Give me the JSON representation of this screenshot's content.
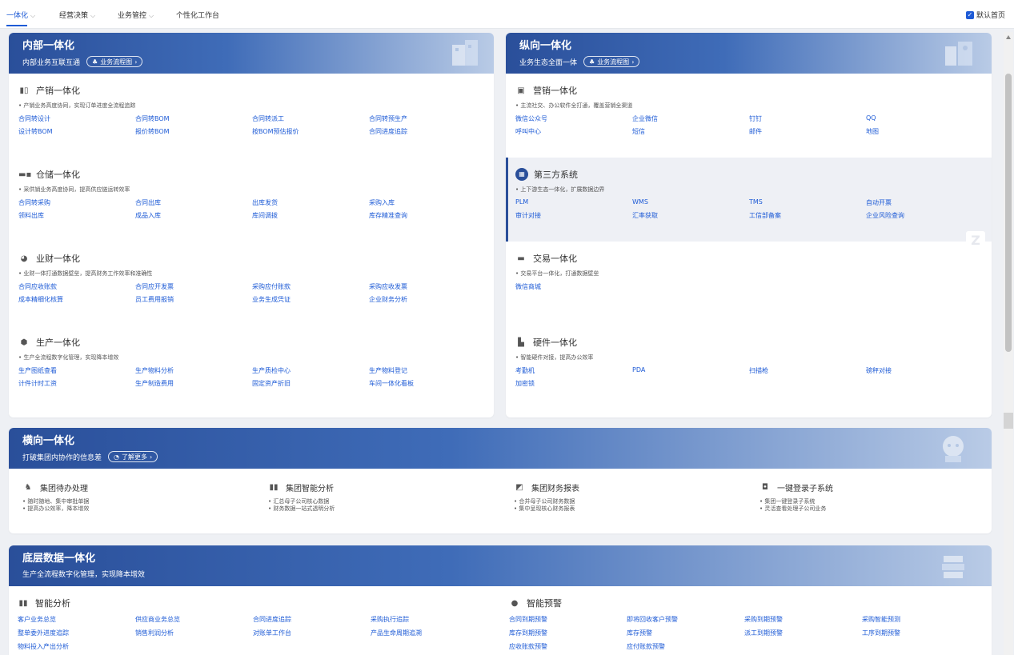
{
  "topnav": {
    "tabs": [
      {
        "label": "一体化",
        "chevron": true
      },
      {
        "label": "经营决策",
        "chevron": true
      },
      {
        "label": "业务管控",
        "chevron": true
      },
      {
        "label": "个性化工作台",
        "chevron": false
      }
    ],
    "default_home_label": "默认首页",
    "default_home_checked": true
  },
  "internal": {
    "title": "内部一体化",
    "subtitle": "内部业务互联互通",
    "pill": "业务流程图",
    "sections": [
      {
        "icon": "building-icon",
        "glyph": "▮▯",
        "title": "产销一体化",
        "desc": "• 产销业务高度协同，实现订单进度全流程追踪",
        "links": [
          "合同转设计",
          "合同转BOM",
          "合同转派工",
          "合同转预生产",
          "设计转BOM",
          "报价转BOM",
          "按BOM预估报价",
          "合同进度追踪"
        ]
      },
      {
        "icon": "truck-icon",
        "glyph": "▬▪",
        "title": "仓储一体化",
        "desc": "• 采供销业务高度协同，提高供应链运转效率",
        "links": [
          "合同转采购",
          "合同出库",
          "出库发货",
          "采购入库",
          "领料出库",
          "成品入库",
          "库间调拨",
          "库存精准查询"
        ]
      },
      {
        "icon": "pie-chart-icon",
        "glyph": "◕",
        "title": "业财一体化",
        "desc": "• 业财一体打通数据壁垒，提高财务工作效率和准确性",
        "links": [
          "合同应收账款",
          "合同应开发票",
          "采购应付账款",
          "采购应收发票",
          "成本精细化核算",
          "员工费用报销",
          "业务生成凭证",
          "企业财务分析"
        ]
      },
      {
        "icon": "cube-icon",
        "glyph": "⬢",
        "title": "生产一体化",
        "desc": "• 生产全流程数字化管理，实现降本增效",
        "links": [
          "生产图纸查看",
          "生产物料分析",
          "生产质检中心",
          "生产物料登记",
          "计件计时工资",
          "生产制造费用",
          "固定资产折旧",
          "车间一体化看板"
        ]
      }
    ]
  },
  "vertical": {
    "title": "纵向一体化",
    "subtitle": "业务生态全面一体",
    "pill": "业务流程图",
    "sections": [
      {
        "icon": "marketing-icon",
        "glyph": "▣",
        "title": "营销一体化",
        "desc": "• 主流社交、办公软件全打通，覆盖营销全渠道",
        "links": [
          "微信公众号",
          "企业微信",
          "钉钉",
          "QQ",
          "呼叫中心",
          "短信",
          "邮件",
          "地图"
        ]
      },
      {
        "icon": "third-party-icon",
        "glyph": "▦",
        "title": "第三方系统",
        "desc": "• 上下游生态一体化，扩展数据边界",
        "links": [
          "PLM",
          "WMS",
          "TMS",
          "自动开票",
          "审计对接",
          "汇率获取",
          "工信部备案",
          "企业风险查询"
        ]
      },
      {
        "icon": "card-icon",
        "glyph": "▬",
        "title": "交易一体化",
        "desc": "• 交易平台一体化，打通数据壁垒",
        "links": [
          "微信商城"
        ]
      },
      {
        "icon": "hardware-icon",
        "glyph": "▙",
        "title": "硬件一体化",
        "desc": "• 智能硬件对接，提高办公效率",
        "links": [
          "考勤机",
          "PDA",
          "扫描枪",
          "磅秤对接",
          "加密锁"
        ]
      }
    ],
    "z_badge": "Z"
  },
  "horizontal": {
    "title": "横向一体化",
    "subtitle": "打破集团内协作的信息差",
    "pill": "了解更多",
    "items": [
      {
        "icon": "bell-icon",
        "glyph": "♞",
        "title": "集团待办处理",
        "bullets": [
          "• 随时随地、集中审批单据",
          "• 提高办公效率，降本增效"
        ]
      },
      {
        "icon": "bar-chart-icon",
        "glyph": "▮▮",
        "title": "集团智能分析",
        "bullets": [
          "• 汇总母子公司核心数据",
          "• 财务数据一站式透明分析"
        ]
      },
      {
        "icon": "report-icon",
        "glyph": "◩",
        "title": "集团财务报表",
        "bullets": [
          "• 合并母子公司财务数据",
          "• 集中呈现核心财务报表"
        ]
      },
      {
        "icon": "login-icon",
        "glyph": "◘",
        "title": "一键登录子系统",
        "bullets": [
          "• 集团一键登录子系统",
          "• 灵活查看处理子公司业务"
        ]
      }
    ]
  },
  "bottom": {
    "title": "底层数据一体化",
    "subtitle": "生产全流程数字化管理，实现降本增效",
    "groups": [
      {
        "icon": "analytics-icon",
        "glyph": "▮▮",
        "title": "智能分析",
        "links": [
          "客户业务总览",
          "供应商业务总览",
          "合同进度追踪",
          "采购执行追踪",
          "整单委外进度追踪",
          "销售利润分析",
          "对账单工作台",
          "产品生命周期追溯",
          "物料投入产出分析"
        ]
      },
      {
        "icon": "alert-icon",
        "glyph": "●",
        "title": "智能预警",
        "links": [
          "合同到期预警",
          "即将回收客户预警",
          "采购到期预警",
          "采购智能预测",
          "库存到期预警",
          "库存预警",
          "派工到期预警",
          "工序到期预警",
          "应收账款预警",
          "应付账款预警"
        ]
      }
    ]
  }
}
